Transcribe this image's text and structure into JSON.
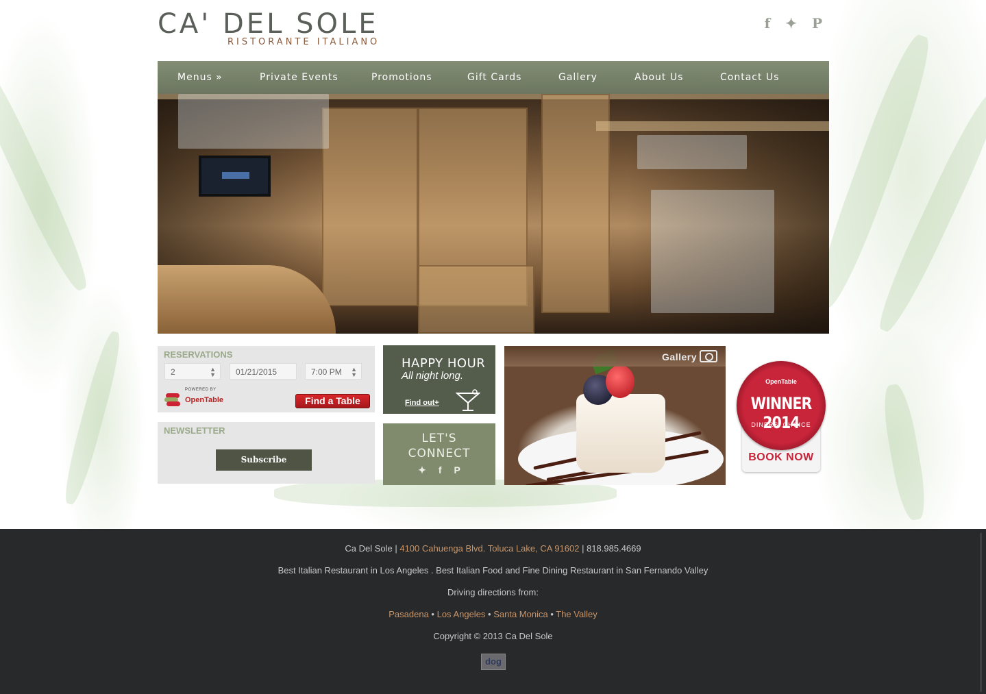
{
  "header": {
    "logo_main": "CA' DEL SOLE",
    "logo_sub": "RISTORANTE ITALIANO",
    "social": [
      "facebook-icon",
      "twitter-icon",
      "pinterest-icon"
    ]
  },
  "nav": {
    "items": [
      "Menus »",
      "Private Events",
      "Promotions",
      "Gift Cards",
      "Gallery",
      "About Us",
      "Contact Us"
    ]
  },
  "reservations": {
    "title": "RESERVATIONS",
    "party_size": "2",
    "date": "01/21/2015",
    "time": "7:00 PM",
    "powered_by": "POWERED BY",
    "opentable_label": "OpenTable",
    "find_button": "Find a Table"
  },
  "newsletter": {
    "title": "NEWSLETTER",
    "subscribe_button": "Subscribe"
  },
  "happy_hour": {
    "title": "HAPPY HOUR",
    "subtitle": "All night long.",
    "link": "Find out+"
  },
  "connect": {
    "line1": "LET'S",
    "line2": "CONNECT"
  },
  "gallery": {
    "label": "Gallery"
  },
  "badge": {
    "opentable": "OpenTable",
    "winner": "WINNER 2014",
    "diners_choice": "DINERS' CHOICE",
    "book_now": "BOOK NOW"
  },
  "footer": {
    "name": "Ca Del Sole",
    "address": "4100 Cahuenga Blvd. Toluca Lake, CA 91602",
    "phone": "818.985.4669",
    "tagline": "Best Italian Restaurant in Los Angeles . Best Italian Food and Fine Dining Restaurant in San Fernando Valley",
    "directions_label": "Driving directions from:",
    "directions": [
      "Pasadena",
      "Los Angeles",
      "Santa Monica",
      "The Valley"
    ],
    "copyright": "Copyright © 2013 Ca Del Sole",
    "credit": "dog"
  },
  "colors": {
    "nav_bg": "#76806a",
    "accent_red": "#c8243a",
    "footer_bg": "#27292a",
    "footer_link": "#c9956a"
  }
}
